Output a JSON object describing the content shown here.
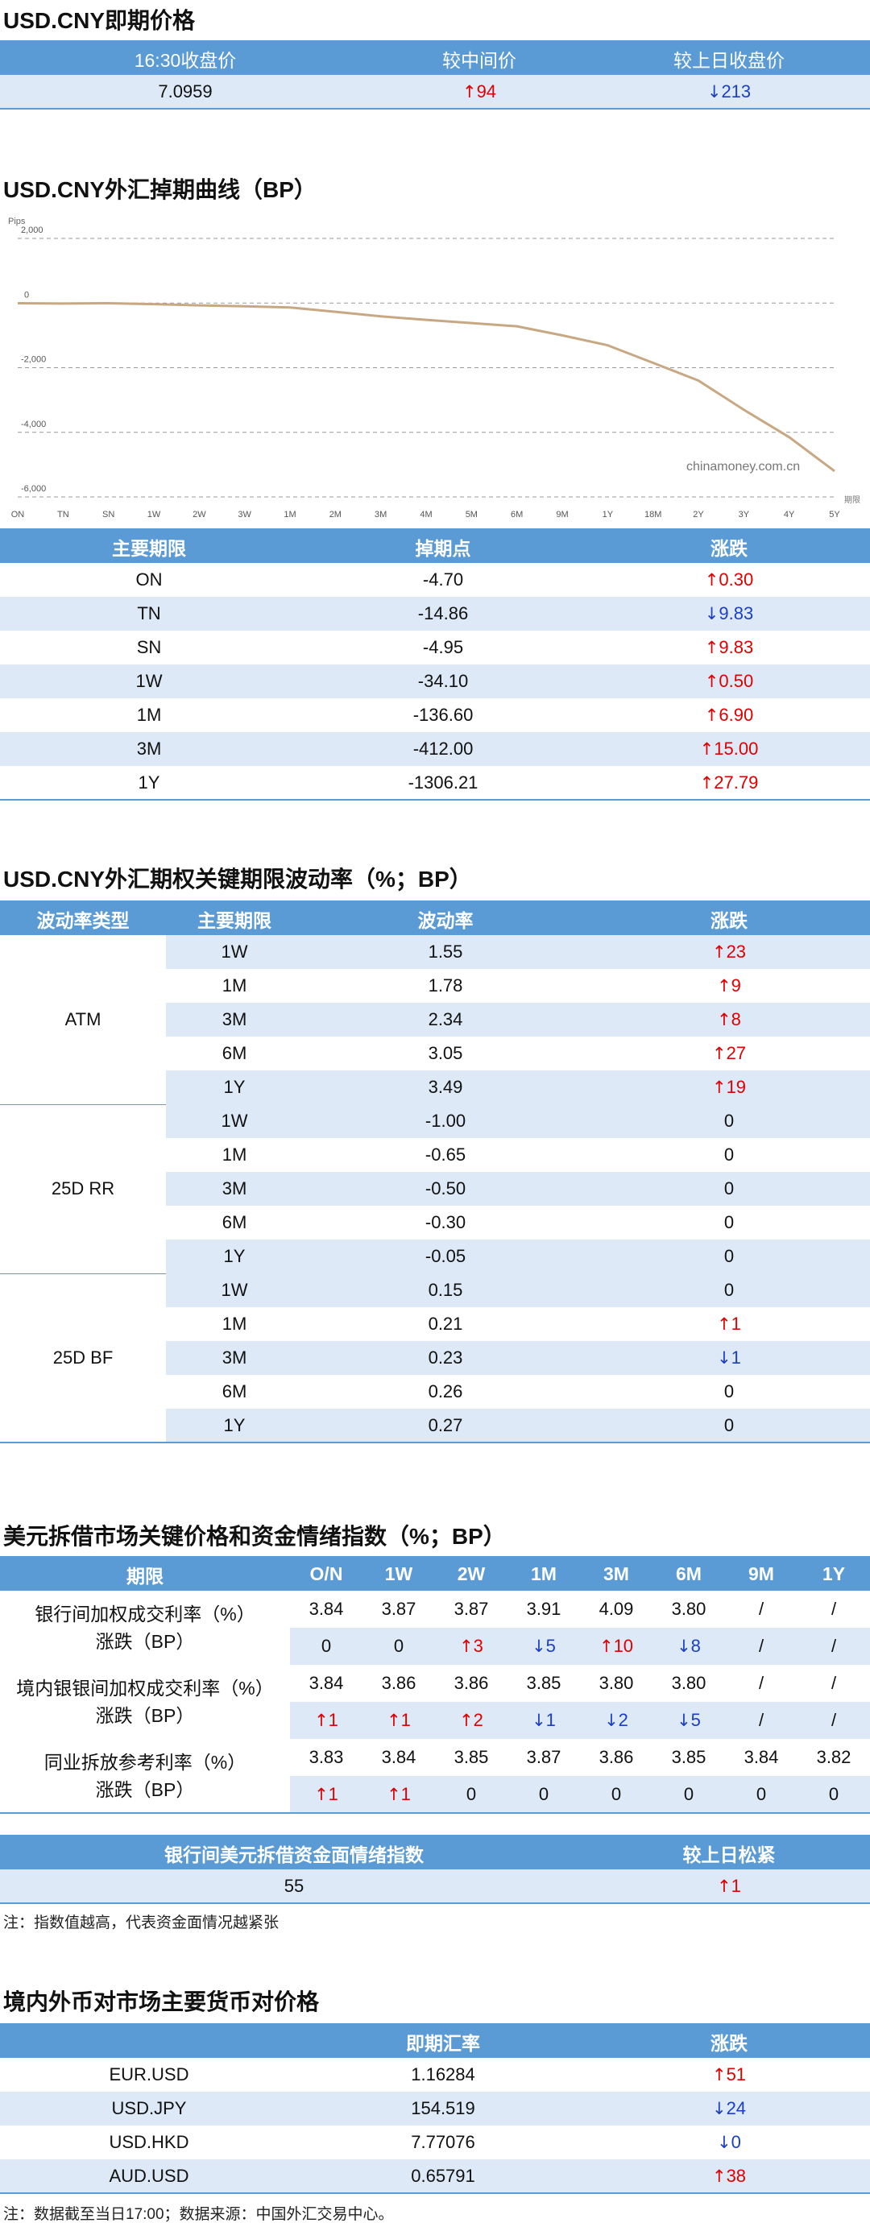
{
  "spot": {
    "title": "USD.CNY即期价格",
    "headers": [
      "16:30收盘价",
      "较中间价",
      "较上日收盘价"
    ],
    "values": [
      {
        "text": "7.0959",
        "dir": ""
      },
      {
        "text": "94",
        "dir": "up"
      },
      {
        "text": "213",
        "dir": "down"
      }
    ]
  },
  "swap": {
    "title": "USD.CNY外汇掉期曲线（BP）",
    "headers": [
      "主要期限",
      "掉期点",
      "涨跌"
    ],
    "rows": [
      {
        "tenor": "ON",
        "points": "-4.70",
        "chg": "0.30",
        "dir": "up"
      },
      {
        "tenor": "TN",
        "points": "-14.86",
        "chg": "9.83",
        "dir": "down"
      },
      {
        "tenor": "SN",
        "points": "-4.95",
        "chg": "9.83",
        "dir": "up"
      },
      {
        "tenor": "1W",
        "points": "-34.10",
        "chg": "0.50",
        "dir": "up"
      },
      {
        "tenor": "1M",
        "points": "-136.60",
        "chg": "6.90",
        "dir": "up"
      },
      {
        "tenor": "3M",
        "points": "-412.00",
        "chg": "15.00",
        "dir": "up"
      },
      {
        "tenor": "1Y",
        "points": "-1306.21",
        "chg": "27.79",
        "dir": "up"
      }
    ]
  },
  "chart_data": {
    "type": "line",
    "ylabel": "Pips",
    "xlabel": "期限",
    "watermark": "chinamoney.com.cn",
    "yticks": [
      "2,000",
      "0",
      "-2,000",
      "-4,000",
      "-6,000"
    ],
    "ytick_values": [
      2000,
      0,
      -2000,
      -4000,
      -6000
    ],
    "ylim": [
      -6000,
      2000
    ],
    "grid": true,
    "line_color": "#c8a882",
    "xticks": [
      "ON",
      "TN",
      "SN",
      "1W",
      "2W",
      "3W",
      "1M",
      "2M",
      "3M",
      "4M",
      "5M",
      "6M",
      "9M",
      "1Y",
      "18M",
      "2Y",
      "3Y",
      "4Y",
      "5Y"
    ],
    "series": [
      {
        "x": [
          "ON",
          "TN",
          "SN",
          "1W",
          "2W",
          "3W",
          "1M",
          "2M",
          "3M",
          "4M",
          "5M",
          "6M",
          "9M",
          "1Y",
          "18M",
          "2Y",
          "3Y",
          "4Y",
          "5Y"
        ],
        "values": [
          -5,
          -15,
          -5,
          -34,
          -70,
          -100,
          -137,
          -270,
          -412,
          -520,
          -620,
          -720,
          -1000,
          -1306,
          -1850,
          -2400,
          -3300,
          -4150,
          -5200
        ]
      }
    ]
  },
  "vol": {
    "title": "USD.CNY外汇期权关键期限波动率（%；BP）",
    "headers": [
      "波动率类型",
      "主要期限",
      "波动率",
      "涨跌"
    ],
    "groups": [
      {
        "type": "ATM",
        "rows": [
          {
            "tenor": "1W",
            "value": "1.55",
            "chg": "23",
            "dir": "up"
          },
          {
            "tenor": "1M",
            "value": "1.78",
            "chg": "9",
            "dir": "up"
          },
          {
            "tenor": "3M",
            "value": "2.34",
            "chg": "8",
            "dir": "up"
          },
          {
            "tenor": "6M",
            "value": "3.05",
            "chg": "27",
            "dir": "up"
          },
          {
            "tenor": "1Y",
            "value": "3.49",
            "chg": "19",
            "dir": "up"
          }
        ]
      },
      {
        "type": "25D RR",
        "rows": [
          {
            "tenor": "1W",
            "value": "-1.00",
            "chg": "0",
            "dir": ""
          },
          {
            "tenor": "1M",
            "value": "-0.65",
            "chg": "0",
            "dir": ""
          },
          {
            "tenor": "3M",
            "value": "-0.50",
            "chg": "0",
            "dir": ""
          },
          {
            "tenor": "6M",
            "value": "-0.30",
            "chg": "0",
            "dir": ""
          },
          {
            "tenor": "1Y",
            "value": "-0.05",
            "chg": "0",
            "dir": ""
          }
        ]
      },
      {
        "type": "25D BF",
        "rows": [
          {
            "tenor": "1W",
            "value": "0.15",
            "chg": "0",
            "dir": ""
          },
          {
            "tenor": "1M",
            "value": "0.21",
            "chg": "1",
            "dir": "up"
          },
          {
            "tenor": "3M",
            "value": "0.23",
            "chg": "1",
            "dir": "down"
          },
          {
            "tenor": "6M",
            "value": "0.26",
            "chg": "0",
            "dir": ""
          },
          {
            "tenor": "1Y",
            "value": "0.27",
            "chg": "0",
            "dir": ""
          }
        ]
      }
    ]
  },
  "lending": {
    "title": "美元拆借市场关键价格和资金情绪指数（%；BP）",
    "headers": [
      "期限",
      "O/N",
      "1W",
      "2W",
      "1M",
      "3M",
      "6M",
      "9M",
      "1Y"
    ],
    "groups": [
      {
        "label_rate": "银行间加权成交利率（%）",
        "label_chg": "涨跌（BP）",
        "rates": [
          "3.84",
          "3.87",
          "3.87",
          "3.91",
          "4.09",
          "3.80",
          "/",
          "/"
        ],
        "chgs": [
          {
            "t": "0",
            "d": ""
          },
          {
            "t": "0",
            "d": ""
          },
          {
            "t": "3",
            "d": "up"
          },
          {
            "t": "5",
            "d": "down"
          },
          {
            "t": "10",
            "d": "up"
          },
          {
            "t": "8",
            "d": "down"
          },
          {
            "t": "/",
            "d": ""
          },
          {
            "t": "/",
            "d": ""
          }
        ]
      },
      {
        "label_rate": "境内银银间加权成交利率（%）",
        "label_chg": "涨跌（BP）",
        "rates": [
          "3.84",
          "3.86",
          "3.86",
          "3.85",
          "3.80",
          "3.80",
          "/",
          "/"
        ],
        "chgs": [
          {
            "t": "1",
            "d": "up"
          },
          {
            "t": "1",
            "d": "up"
          },
          {
            "t": "2",
            "d": "up"
          },
          {
            "t": "1",
            "d": "down"
          },
          {
            "t": "2",
            "d": "down"
          },
          {
            "t": "5",
            "d": "down"
          },
          {
            "t": "/",
            "d": ""
          },
          {
            "t": "/",
            "d": ""
          }
        ]
      },
      {
        "label_rate": "同业拆放参考利率（%）",
        "label_chg": "涨跌（BP）",
        "rates": [
          "3.83",
          "3.84",
          "3.85",
          "3.87",
          "3.86",
          "3.85",
          "3.84",
          "3.82"
        ],
        "chgs": [
          {
            "t": "1",
            "d": "up"
          },
          {
            "t": "1",
            "d": "up"
          },
          {
            "t": "0",
            "d": ""
          },
          {
            "t": "0",
            "d": ""
          },
          {
            "t": "0",
            "d": ""
          },
          {
            "t": "0",
            "d": ""
          },
          {
            "t": "0",
            "d": ""
          },
          {
            "t": "0",
            "d": ""
          }
        ]
      }
    ],
    "sentiment": {
      "headers": [
        "银行间美元拆借资金面情绪指数",
        "较上日松紧"
      ],
      "value": "55",
      "chg": "1",
      "dir": "up"
    },
    "note": "注：指数值越高，代表资金面情况越紧张"
  },
  "fx": {
    "title": "境内外币对市场主要货币对价格",
    "headers": [
      "",
      "即期汇率",
      "涨跌"
    ],
    "rows": [
      {
        "pair": "EUR.USD",
        "rate": "1.16284",
        "chg": "51",
        "dir": "up"
      },
      {
        "pair": "USD.JPY",
        "rate": "154.519",
        "chg": "24",
        "dir": "down"
      },
      {
        "pair": "USD.HKD",
        "rate": "7.77076",
        "chg": "0",
        "dir": "down"
      },
      {
        "pair": "AUD.USD",
        "rate": "0.65791",
        "chg": "38",
        "dir": "up"
      }
    ],
    "note": "注：数据截至当日17:00；数据来源：中国外汇交易中心。"
  }
}
